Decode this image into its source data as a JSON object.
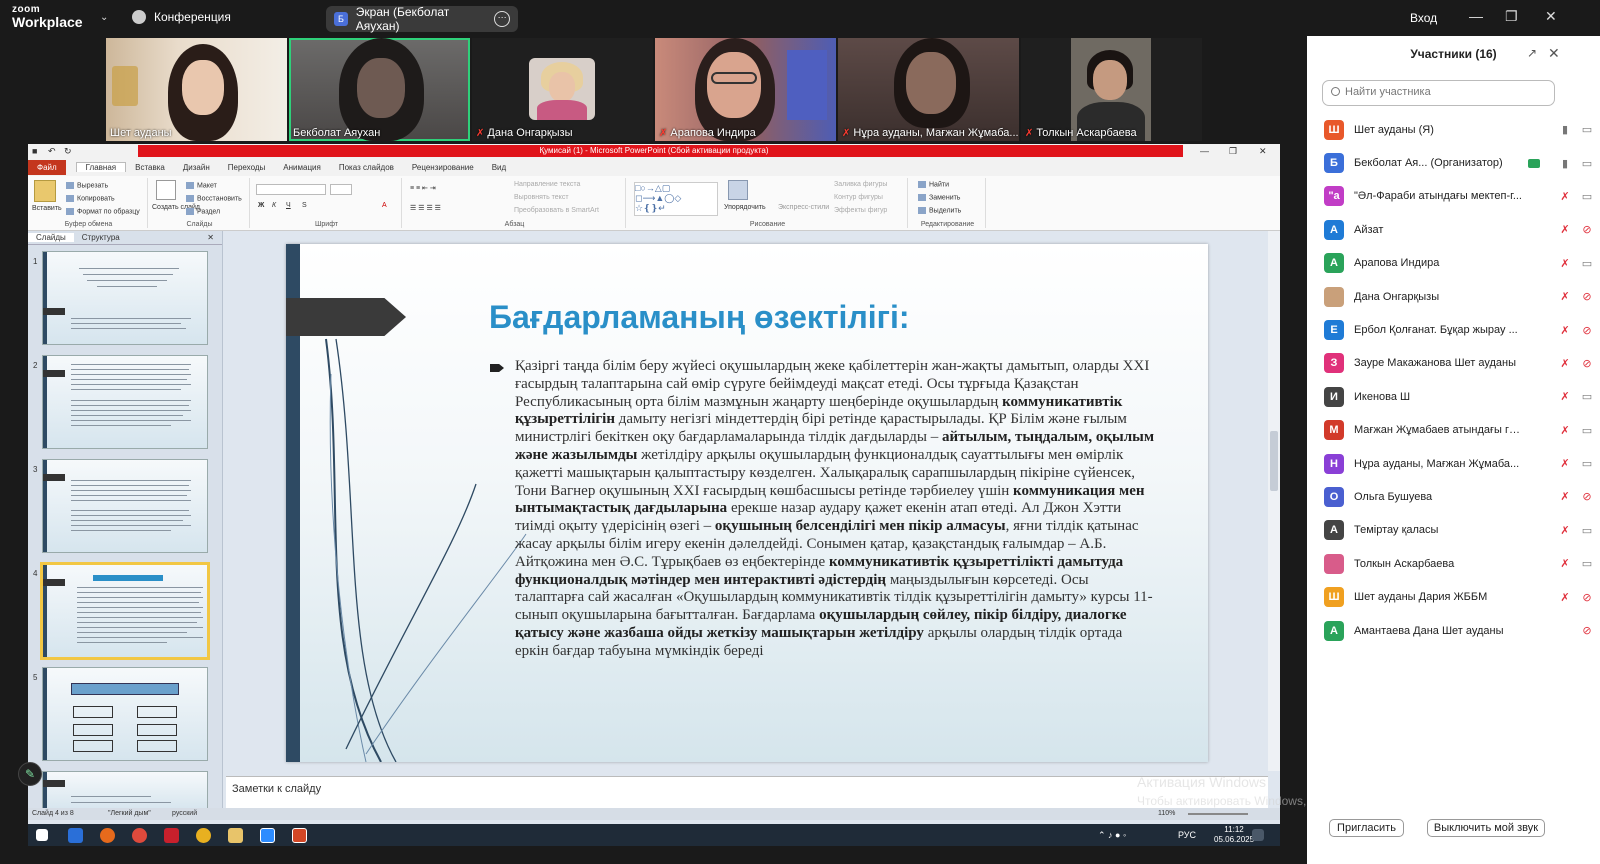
{
  "zoom": {
    "logo_line1": "zoom",
    "logo_line2": "Workplace",
    "conference_label": "Конференция",
    "share_label": "Экран (Бекболат Аяухан)",
    "share_badge": "Б",
    "login": "Вход",
    "accent": "#2fd07a"
  },
  "videos": [
    {
      "name": "Шет ауданы",
      "muted": false
    },
    {
      "name": "Бекболат Аяухан",
      "muted": false
    },
    {
      "name": "Дана Онгарқызы",
      "muted": true
    },
    {
      "name": "Арапова Индира",
      "muted": true
    },
    {
      "name": "Нұра ауданы, Мағжан Жұмаба...",
      "muted": true
    },
    {
      "name": "Толкын Аскарбаева",
      "muted": true
    }
  ],
  "participants": {
    "title": "Участники (16)",
    "search_placeholder": "Найти участника",
    "invite_label": "Пригласить",
    "mute_label": "Выключить мой звук",
    "list": [
      {
        "initial": "Ш",
        "color": "#e8582a",
        "name": "Шет ауданы (Я)",
        "mic": "on",
        "cam": "on"
      },
      {
        "initial": "Б",
        "color": "#3b6fd9",
        "name": "Бекболат Ая... (Организатор)",
        "mic": "on",
        "cam": "on"
      },
      {
        "initial": "\"a",
        "color": "#c13dc6",
        "name": "\"Әл-Фараби атындағы мектеп-г...",
        "mic": "off",
        "cam": "on"
      },
      {
        "initial": "А",
        "color": "#1f7bd6",
        "name": "Айзат",
        "mic": "off",
        "cam": "off"
      },
      {
        "initial": "А",
        "color": "#2aa35a",
        "name": "Арапова Индира",
        "mic": "off",
        "cam": "on"
      },
      {
        "initial": "",
        "color": "#c9a07a",
        "name": "Дана Онгарқызы",
        "mic": "off",
        "cam": "off"
      },
      {
        "initial": "Е",
        "color": "#1f7bd6",
        "name": "Ербол Қолғанат. Бұқар жырау ...",
        "mic": "off",
        "cam": "off"
      },
      {
        "initial": "З",
        "color": "#e0317a",
        "name": "Зауре Макажанова Шет ауданы",
        "mic": "off",
        "cam": "off"
      },
      {
        "initial": "И",
        "color": "#444444",
        "name": "Икенова Ш",
        "mic": "off",
        "cam": "on"
      },
      {
        "initial": "М",
        "color": "#d23a2a",
        "name": "Мағжан Жұмабаев атындағы ги...",
        "mic": "off",
        "cam": "on"
      },
      {
        "initial": "Н",
        "color": "#8a3fd6",
        "name": "Нұра ауданы, Мағжан Жұмаба...",
        "mic": "off",
        "cam": "on"
      },
      {
        "initial": "О",
        "color": "#4a5fd0",
        "name": "Ольга Бушуева",
        "mic": "off",
        "cam": "off"
      },
      {
        "initial": "А",
        "color": "#444444",
        "name": "Теміртау қаласы",
        "mic": "off",
        "cam": "on"
      },
      {
        "initial": "",
        "color": "#d85c8a",
        "name": "Толкын Аскарбаева",
        "mic": "off",
        "cam": "on"
      },
      {
        "initial": "Ш",
        "color": "#f0a020",
        "name": "Шет ауданы Дария ЖББМ",
        "mic": "off",
        "cam": "off"
      },
      {
        "initial": "А",
        "color": "#2aa35a",
        "name": "Амантаева Дана Шет ауданы",
        "mic": "none",
        "cam": "off"
      }
    ]
  },
  "ppt": {
    "window_title": "Қумисай (1) - Microsoft PowerPoint (Сбой активации продукта)",
    "tabs": [
      "Главная",
      "Вставка",
      "Дизайн",
      "Переходы",
      "Анимация",
      "Показ слайдов",
      "Рецензирование",
      "Вид"
    ],
    "file_tab": "Файл",
    "groups": {
      "clipboard": "Буфер обмена",
      "slides": "Слайды",
      "font": "Шрифт",
      "paragraph": "Абзац",
      "drawing": "Рисование",
      "editing": "Редактирование"
    },
    "ribbon_items": {
      "paste": "Вставить",
      "cut": "Вырезать",
      "copy": "Копировать",
      "format": "Формат по образцу",
      "create_slide": "Создать слайд",
      "layout": "Макет",
      "restore": "Восстановить",
      "section": "Раздел",
      "text_dir": "Направление текста",
      "align_text": "Выровнять текст",
      "smartart": "Преобразовать в SmartArt",
      "arrange": "Упорядочить",
      "quick_styles": "Экспресс-стили",
      "fill": "Заливка фигуры",
      "outline": "Контур фигуры",
      "effects": "Эффекты фигур",
      "find": "Найти",
      "replace": "Заменить",
      "select": "Выделить"
    },
    "sidebar_tabs": [
      "Слайды",
      "Структура"
    ],
    "slide_numbers": [
      "1",
      "2",
      "3",
      "4",
      "5"
    ],
    "notes_placeholder": "Заметки к слайду",
    "status": {
      "slide": "Слайд 4 из 8",
      "theme": "\"Легкий дым\"",
      "lang": "русский",
      "zoom": "110%"
    }
  },
  "slide": {
    "heading": "Бағдарламаның өзектілігі:",
    "heading_color": "#2a8fc8"
  },
  "activation": {
    "line1": "Активация Windows",
    "line2": "Чтобы активировать Windows, перейдите в раздел \"Параметры\"."
  },
  "taskbar": {
    "lang": "РУС",
    "time": "11:12",
    "date": "05.06.2025"
  }
}
